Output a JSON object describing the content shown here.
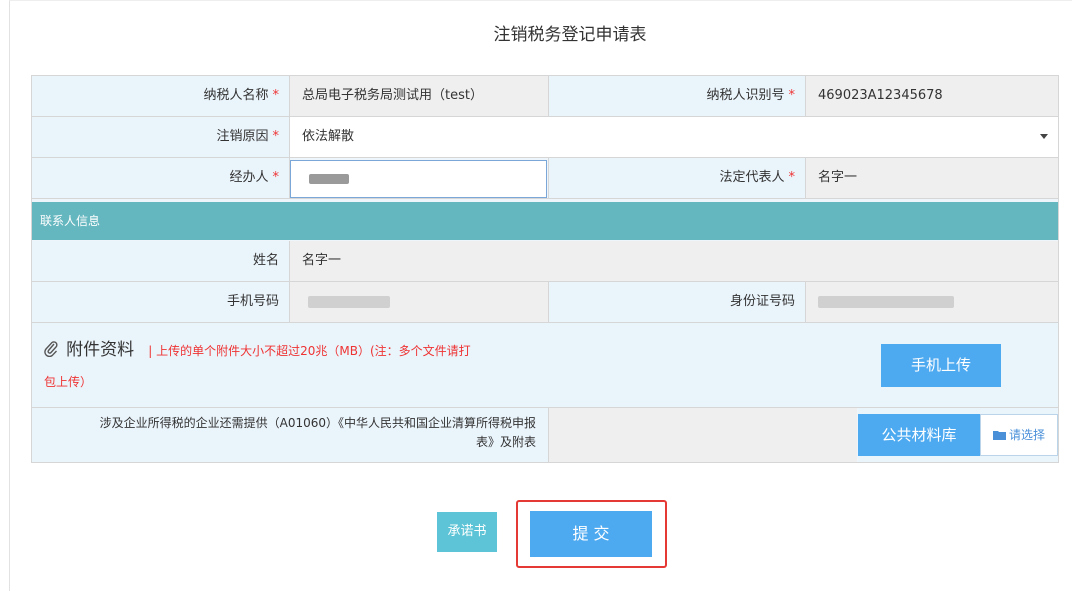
{
  "title": "注销税务登记申请表",
  "form": {
    "taxpayer_name_label": "纳税人名称",
    "taxpayer_name_value": "总局电子税务局测试用（test）",
    "taxpayer_id_label": "纳税人识别号",
    "taxpayer_id_value": "469023A12345678",
    "cancel_reason_label": "注销原因",
    "cancel_reason_value": "依法解散",
    "handler_label": "经办人",
    "legal_rep_label": "法定代表人",
    "legal_rep_value": "名字一",
    "required_mark": "*"
  },
  "contact": {
    "section_title": "联系人信息",
    "name_label": "姓名",
    "name_value": "名字一",
    "phone_label": "手机号码",
    "id_label": "身份证号码"
  },
  "attachment": {
    "title": "附件资料",
    "note_line1": "| 上传的单个附件大小不超过20兆（MB）(注：多个文件请打",
    "note_line2": "包上传）",
    "mobile_upload_label": "手机上传",
    "extra_line1": "涉及企业所得税的企业还需提供（A01060）《中华人民共和国企业清算所得税申报",
    "extra_line2": "表》及附表",
    "public_library_label": "公共材料库",
    "choose_label": "请选择"
  },
  "actions": {
    "promise_label": "承诺书",
    "submit_label": "提  交"
  },
  "colors": {
    "section_header": "#64b6bf",
    "button_blue": "#4eaaf0",
    "required": "#ee3333",
    "highlight_box": "#e53935"
  },
  "icons": {
    "paperclip": "paperclip-icon",
    "folder": "folder-icon",
    "dropdown": "caret-down-icon"
  }
}
